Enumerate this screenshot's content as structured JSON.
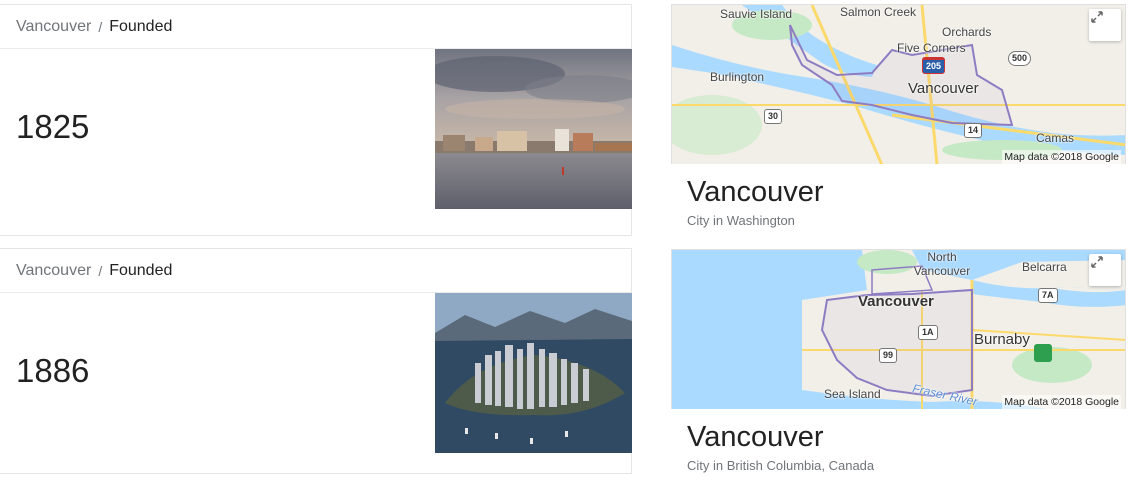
{
  "results": [
    {
      "breadcrumb": {
        "city": "Vancouver",
        "separator": "/",
        "field": "Founded"
      },
      "year": "1825",
      "photo_icon": "waterfront-photo"
    },
    {
      "breadcrumb": {
        "city": "Vancouver",
        "separator": "/",
        "field": "Founded"
      },
      "year": "1886",
      "photo_icon": "skyline-aerial-photo"
    }
  ],
  "maps": [
    {
      "title": "Vancouver",
      "subtitle": "City in Washington",
      "attribution": "Map data ©2018 Google",
      "labels": {
        "sauvie": "Sauvie Island",
        "salmon": "Salmon Creek",
        "orchards": "Orchards",
        "five": "Five Corners",
        "burlington": "Burlington",
        "city": "Vancouver",
        "camas": "Camas"
      },
      "shields": {
        "i205": "205",
        "r500": "500",
        "r30": "30",
        "r14": "14"
      }
    },
    {
      "title": "Vancouver",
      "subtitle": "City in British Columbia, Canada",
      "attribution": "Map data ©2018 Google",
      "labels": {
        "north": "North Vancouver",
        "belcarra": "Belcarra",
        "city": "Vancouver",
        "burnaby": "Burnaby",
        "sea": "Sea Island",
        "fraser": "Fraser River"
      },
      "shields": {
        "r7a": "7A",
        "r1a": "1A",
        "r99": "99"
      }
    }
  ],
  "colors": {
    "water": "#aadaff",
    "land": "#f2efe9",
    "park": "#c5e8c5",
    "boundary": "#8e7cc3",
    "road": "#fbd96b"
  }
}
